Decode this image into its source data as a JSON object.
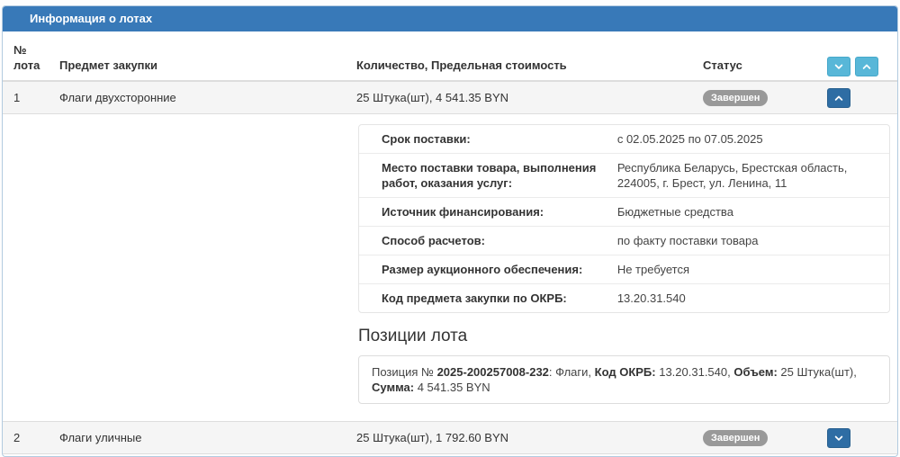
{
  "panel": {
    "title": "Информация о лотах"
  },
  "table": {
    "headers": {
      "num": "№ лота",
      "subject": "Предмет закупки",
      "quantity": "Количество, Предельная стоимость",
      "status": "Статус"
    }
  },
  "lots": [
    {
      "num": "1",
      "subject": "Флаги двухсторонние",
      "quantity": "25 Штука(шт), 4 541.35 BYN",
      "status": "Завершен",
      "expanded": true
    },
    {
      "num": "2",
      "subject": "Флаги уличные",
      "quantity": "25 Штука(шт), 1 792.60 BYN",
      "status": "Завершен",
      "expanded": false
    }
  ],
  "lot_details": {
    "rows": [
      {
        "label": "Срок поставки:",
        "value": "с 02.05.2025 по 07.05.2025"
      },
      {
        "label": "Место поставки товара, выполнения работ, оказания услуг:",
        "value": "Республика Беларусь, Брестская область, 224005, г. Брест, ул. Ленина, 11"
      },
      {
        "label": "Источник финансирования:",
        "value": "Бюджетные средства"
      },
      {
        "label": "Способ расчетов:",
        "value": "по факту поставки товара"
      },
      {
        "label": "Размер аукционного обеспечения:",
        "value": "Не требуется"
      },
      {
        "label": "Код предмета закупки по ОКРБ:",
        "value": "13.20.31.540"
      }
    ],
    "positions_title": "Позиции лота",
    "position": {
      "prefix": "Позиция № ",
      "number": "2025-200257008-232",
      "after_number": ": Флаги, ",
      "okrb_label": "Код ОКРБ:",
      "okrb_value": " 13.20.31.540, ",
      "volume_label": "Объем:",
      "volume_value": " 25 Штука(шт), ",
      "sum_label": "Сумма:",
      "sum_value": " 4 541.35 BYN"
    }
  },
  "icons": {
    "collapse_all": "chevron-down-icon",
    "expand_all": "chevron-up-icon",
    "lot1_toggle": "chevron-up-icon",
    "lot2_toggle": "chevron-down-icon"
  },
  "colors": {
    "panel_header_bg": "#3879b8",
    "panel_border": "#b3cbe0",
    "light_button_bg": "#58b7d8",
    "dark_button_bg": "#2e6da4",
    "badge_bg": "#999999",
    "stripe_bg": "#f5f5f5",
    "row_border": "#dddddd"
  }
}
